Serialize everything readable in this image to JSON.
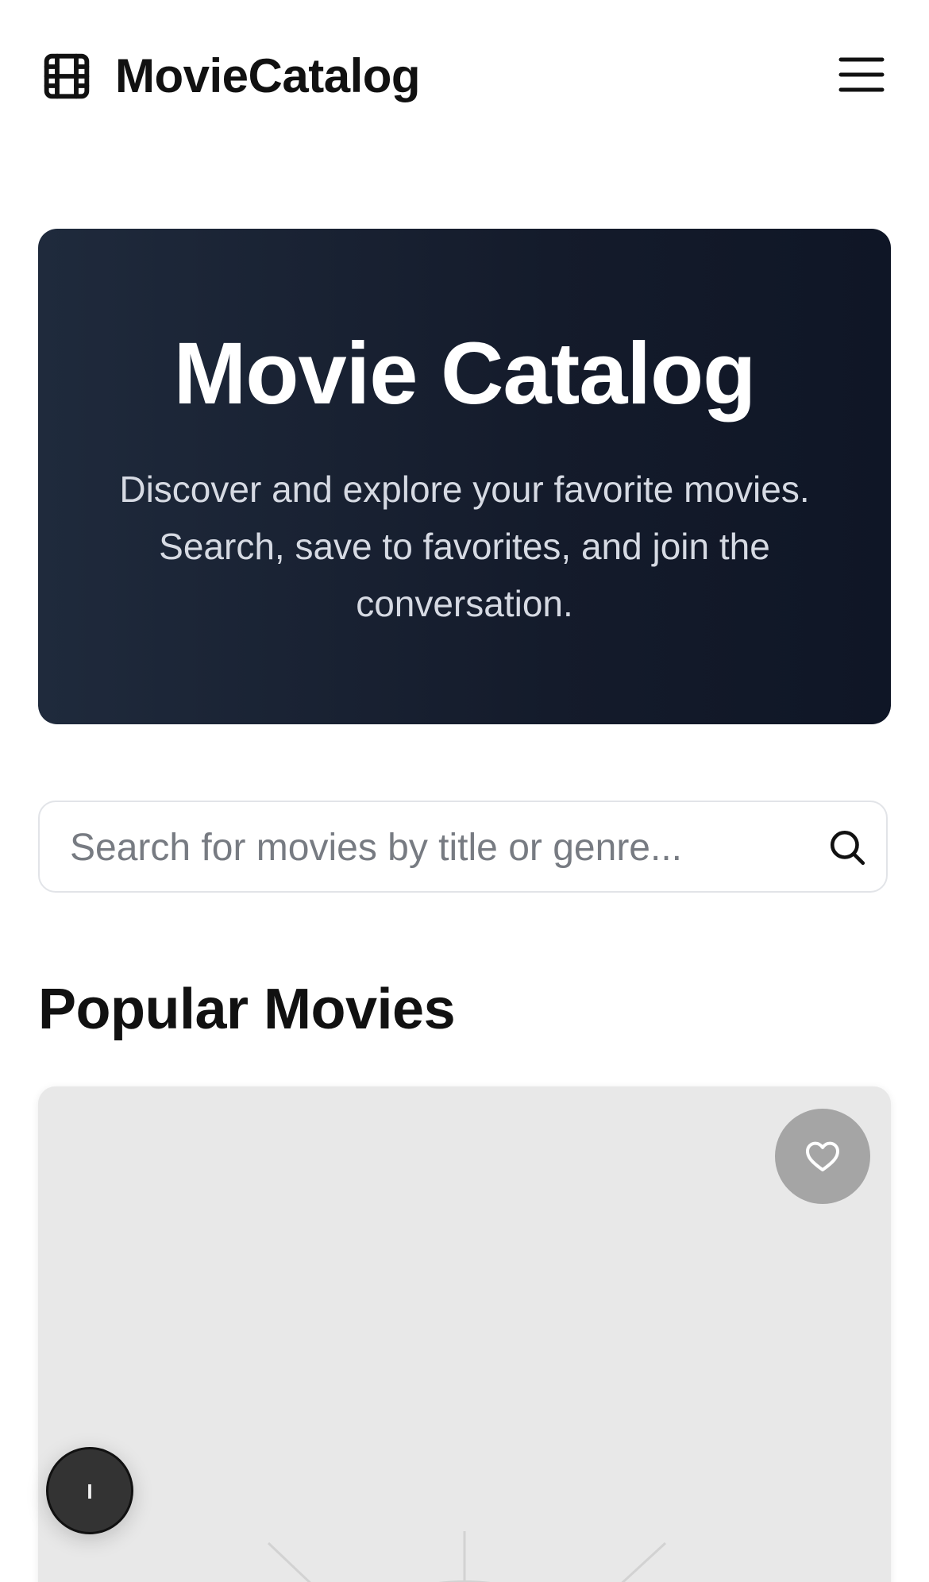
{
  "header": {
    "brand": "MovieCatalog",
    "logo_icon": "film-icon",
    "menu_icon": "hamburger-menu-icon"
  },
  "hero": {
    "title": "Movie Catalog",
    "subtitle": "Discover and explore your favorite movies. Search, save to favorites, and join the conversation."
  },
  "search": {
    "placeholder": "Search for movies by title or genre...",
    "value": "",
    "icon": "search-icon"
  },
  "sections": {
    "popular_title": "Popular Movies"
  },
  "movie_card": {
    "favorite_icon": "heart-icon"
  },
  "floating_button": {
    "label": "I"
  },
  "colors": {
    "hero_start": "#1f2a3c",
    "hero_end": "#0f1626",
    "card_bg": "#e8e8e8",
    "favorite_btn": "#a5a5a5",
    "floating_btn": "#333333"
  }
}
